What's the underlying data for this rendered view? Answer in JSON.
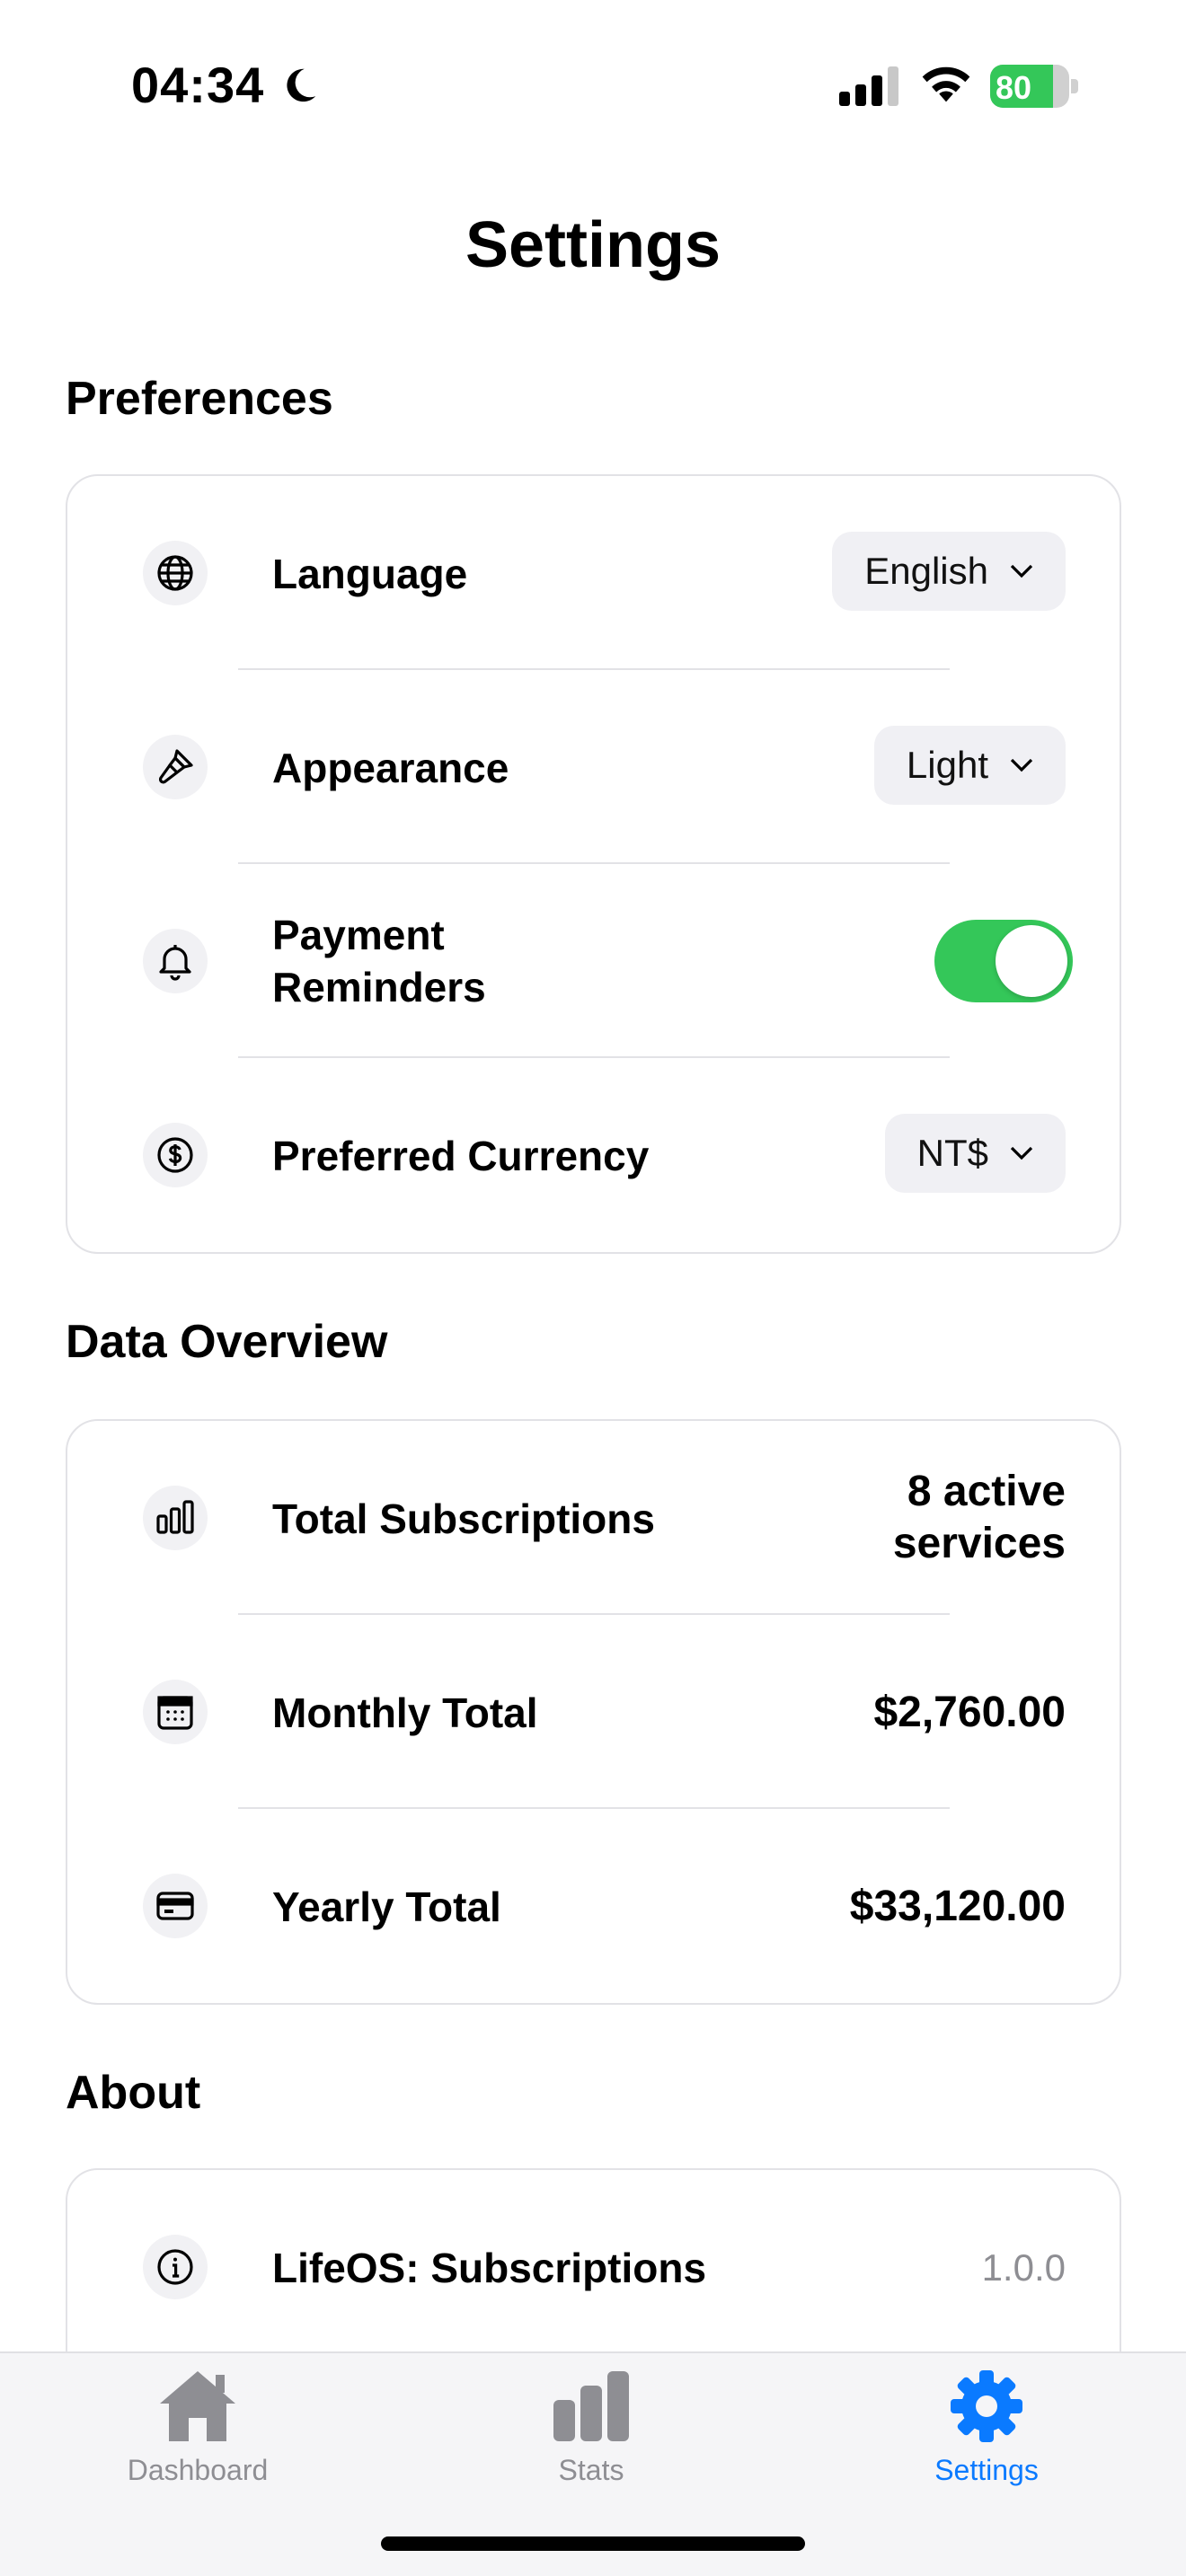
{
  "status_bar": {
    "time": "04:34",
    "battery_level": "80",
    "battery_fraction": 0.8,
    "icons": [
      "moon-icon",
      "cellular-signal-icon",
      "wifi-icon",
      "battery-icon"
    ]
  },
  "header": {
    "title": "Settings"
  },
  "preferences": {
    "title": "Preferences",
    "language": {
      "label": "Language",
      "value": "English",
      "icon": "globe-icon"
    },
    "appearance": {
      "label": "Appearance",
      "value": "Light",
      "icon": "paintbrush-icon"
    },
    "payment_reminders": {
      "label": "Payment Reminders",
      "enabled": true,
      "icon": "bell-icon"
    },
    "currency": {
      "label": "Preferred Currency",
      "value": "NT$",
      "icon": "dollar-circle-icon"
    }
  },
  "data_overview": {
    "title": "Data Overview",
    "total_subscriptions": {
      "label": "Total Subscriptions",
      "value": "8 active services",
      "icon": "bar-chart-icon"
    },
    "monthly_total": {
      "label": "Monthly Total",
      "value": "$2,760.00",
      "icon": "calendar-icon"
    },
    "yearly_total": {
      "label": "Yearly Total",
      "value": "$33,120.00",
      "icon": "credit-card-icon"
    }
  },
  "about": {
    "title": "About",
    "app": {
      "label": "LifeOS: Subscriptions",
      "version": "1.0.0",
      "icon": "info-icon"
    }
  },
  "tab_bar": {
    "tabs": [
      {
        "label": "Dashboard",
        "icon": "house-icon",
        "active": false
      },
      {
        "label": "Stats",
        "icon": "bar-chart-icon",
        "active": false
      },
      {
        "label": "Settings",
        "icon": "gear-icon",
        "active": true
      }
    ]
  },
  "colors": {
    "accent": "#0a7aff",
    "toggle_on": "#34c759",
    "muted": "#8e8e93",
    "border": "#e2e2e6"
  }
}
